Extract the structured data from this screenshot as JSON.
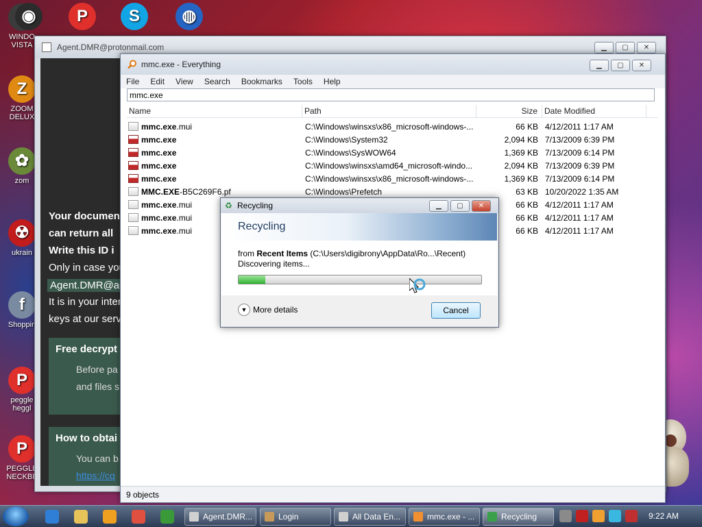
{
  "desktop": {
    "icons": [
      {
        "label": "WINDO\nVISTA",
        "glyph": "●",
        "color": "#3b3b3b"
      },
      {
        "label": "ZOOM\nDELUX",
        "glyph": "Z",
        "color": "#e08a14"
      },
      {
        "label": "zom",
        "glyph": "✿",
        "color": "#6a8a3a"
      },
      {
        "label": "ukrain",
        "glyph": "☢",
        "color": "#c21c1c"
      },
      {
        "label": "Shoppin",
        "glyph": "f",
        "color": "#7a8aa0"
      },
      {
        "label": "peggle\nheggl",
        "glyph": "P",
        "color": "#e0302c"
      },
      {
        "label": "PEGGLE\nNECKBE",
        "glyph": "P",
        "color": "#e0302c"
      }
    ],
    "top_icons": [
      {
        "name": "vista-icon",
        "glyph": "◉",
        "color": "#2c2c2c"
      },
      {
        "name": "peggle-icon",
        "glyph": "P",
        "color": "#e0302c"
      },
      {
        "name": "skype-icon",
        "glyph": "S",
        "color": "#12a5e6"
      },
      {
        "name": "globe-icon",
        "glyph": "◍",
        "color": "#2565c4"
      }
    ]
  },
  "ransom_window": {
    "title": "Agent.DMR@protonmail.com",
    "lines": [
      "Your documen",
      "can return all",
      "Write this ID i",
      "Only in case you",
      "Agent.DMR@ac",
      "It is in your inter",
      "keys at our serv"
    ],
    "box1_title": "Free decrypt",
    "box1_text": [
      "Before pa",
      "and files s"
    ],
    "box2_title": "How to obtai",
    "box2_text": [
      "You can b",
      "https://cq"
    ]
  },
  "everything_window": {
    "title": "mmc.exe - Everything",
    "menu": [
      "File",
      "Edit",
      "View",
      "Search",
      "Bookmarks",
      "Tools",
      "Help"
    ],
    "search_value": "mmc.exe",
    "columns": [
      "Name",
      "Path",
      "Size",
      "Date Modified"
    ],
    "rows": [
      {
        "bold": "mmc.exe",
        "rest": ".mui",
        "type": "mui",
        "path": "C:\\Windows\\winsxs\\x86_microsoft-windows-...",
        "size": "66 KB",
        "date": "4/12/2011 1:17 AM"
      },
      {
        "bold": "mmc.exe",
        "rest": "",
        "type": "exe",
        "path": "C:\\Windows\\System32",
        "size": "2,094 KB",
        "date": "7/13/2009 6:39 PM"
      },
      {
        "bold": "mmc.exe",
        "rest": "",
        "type": "exe",
        "path": "C:\\Windows\\SysWOW64",
        "size": "1,369 KB",
        "date": "7/13/2009 6:14 PM"
      },
      {
        "bold": "mmc.exe",
        "rest": "",
        "type": "exe",
        "path": "C:\\Windows\\winsxs\\amd64_microsoft-windo...",
        "size": "2,094 KB",
        "date": "7/13/2009 6:39 PM"
      },
      {
        "bold": "mmc.exe",
        "rest": "",
        "type": "exe",
        "path": "C:\\Windows\\winsxs\\x86_microsoft-windows-...",
        "size": "1,369 KB",
        "date": "7/13/2009 6:14 PM"
      },
      {
        "bold": "MMC.EXE",
        "rest": "-B5C269F6.pf",
        "type": "mui",
        "path": "C:\\Windows\\Prefetch",
        "size": "63 KB",
        "date": "10/20/2022 1:35 AM"
      },
      {
        "bold": "mmc.exe",
        "rest": ".mui",
        "type": "mui",
        "path": "",
        "size": "66 KB",
        "date": "4/12/2011 1:17 AM"
      },
      {
        "bold": "mmc.exe",
        "rest": ".mui",
        "type": "mui",
        "path": "",
        "size": "66 KB",
        "date": "4/12/2011 1:17 AM"
      },
      {
        "bold": "mmc.exe",
        "rest": ".mui",
        "type": "mui",
        "path": "",
        "size": "66 KB",
        "date": "4/12/2011 1:17 AM"
      }
    ],
    "status": "9 objects"
  },
  "recycling_dialog": {
    "title": "Recycling",
    "heading": "Recycling",
    "from_prefix": "from ",
    "from_name": "Recent Items",
    "from_path": " (C:\\Users\\digibrony\\AppData\\Ro...\\Recent)",
    "status": "Discovering items...",
    "progress": 0.11,
    "more_details": "More details",
    "cancel": "Cancel"
  },
  "taskbar": {
    "quick_launch": [
      {
        "name": "ie-icon",
        "color": "#2f7fd6"
      },
      {
        "name": "explorer-icon",
        "color": "#e8c35a"
      },
      {
        "name": "media-player-icon",
        "color": "#f0a020"
      },
      {
        "name": "paint-icon",
        "color": "#e05040"
      },
      {
        "name": "chrome-icon",
        "color": "#3a9a3a"
      }
    ],
    "buttons": [
      {
        "label": "Agent.DMR...",
        "color": "#d0d0d0",
        "active": false
      },
      {
        "label": "Login",
        "color": "#c89a5a",
        "active": false
      },
      {
        "label": "All Data En...",
        "color": "#d0d0d0",
        "active": false
      },
      {
        "label": "mmc.exe - ...",
        "color": "#f09030",
        "active": false
      },
      {
        "label": "Recycling",
        "color": "#3aa04a",
        "active": true
      }
    ],
    "tray": [
      {
        "name": "tray-app-icon",
        "color": "#8a8a8a"
      },
      {
        "name": "tray-v-icon",
        "color": "#c02020"
      },
      {
        "name": "tray-search-icon",
        "color": "#f0a030"
      },
      {
        "name": "tray-network-icon",
        "color": "#3ab8e0"
      },
      {
        "name": "tray-record-icon",
        "color": "#c03030"
      }
    ],
    "clock": "9:22 AM"
  }
}
